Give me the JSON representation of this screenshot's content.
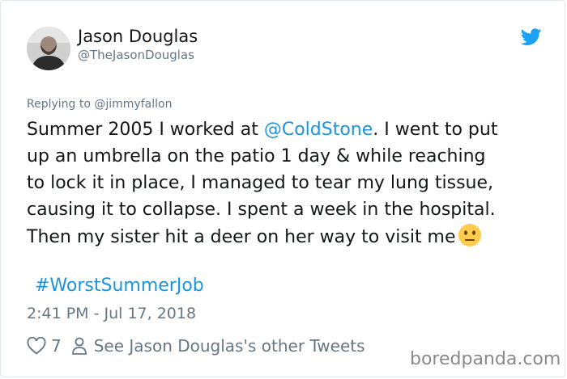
{
  "author": {
    "display_name": "Jason Douglas",
    "handle": "@TheJasonDouglas"
  },
  "reply": {
    "prefix": "Replying to ",
    "mention": "@jimmyfallon"
  },
  "tweet": {
    "line1_before": "Summer 2005 I worked at ",
    "line1_mention": "@ColdStone",
    "line1_after": ". I went to put",
    "line2": "up an umbrella on the patio 1 day & while reaching",
    "line3": "to lock it in place, I managed to tear my lung tissue,",
    "line4": "causing it to collapse. I spent a week in the hospital.",
    "line5": "Then my sister hit a deer on her way to visit me",
    "emoji_icon": "neutral-face-emoji"
  },
  "hashtag": "#WorstSummerJob",
  "timestamp": "2:41 PM - Jul 17, 2018",
  "actions": {
    "like_count": "7",
    "other_tweets_label": "See Jason Douglas's other Tweets"
  },
  "watermark": "boredpanda.com",
  "colors": {
    "link": "#1b95e0",
    "muted": "#657786",
    "text": "#14171a",
    "twitter_blue": "#1da1f2"
  }
}
